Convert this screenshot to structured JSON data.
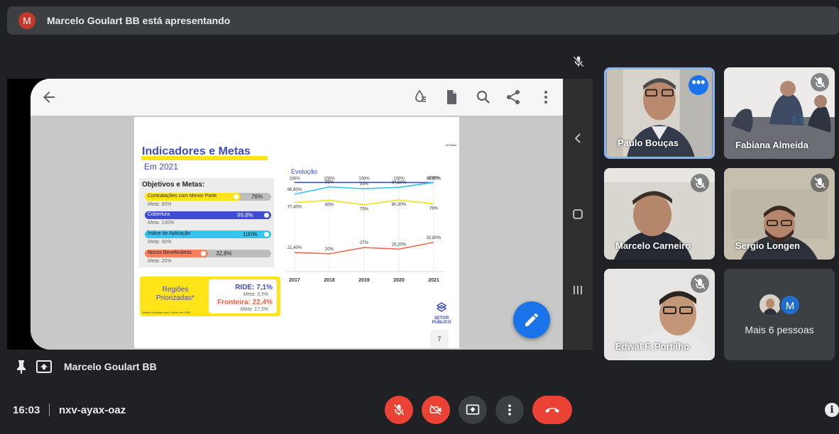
{
  "banner": {
    "avatar_letter": "M",
    "text": "Marcelo Goulart BB está apresentando"
  },
  "slide": {
    "title": "Indicadores e Metas",
    "subtitle": "Em 2021",
    "tag": "#Pública",
    "objectives_title": "Objetivos e Metas:",
    "objectives": [
      {
        "label": "Contratações com Menor Porte",
        "value": "76%",
        "meta": "Meta: 60%",
        "fill": 0.76,
        "color": "#ffe41a"
      },
      {
        "label": "Cobertura",
        "value": "99,8%",
        "meta": "Meta: 100%",
        "fill": 1.0,
        "color": "#3d4bd1"
      },
      {
        "label": "Índice de Aplicação",
        "value": "100%",
        "meta": "Meta: 90%",
        "fill": 1.0,
        "color": "#35c5f0"
      },
      {
        "label": "Novos Beneficiários",
        "value": "32,8%",
        "meta": "Meta: 20%",
        "fill": 0.5,
        "color": "#f68060"
      }
    ],
    "regions": {
      "title": "Regiões Priorizadas*",
      "ride": "RIDE: 7,1%",
      "ride_meta": "Meta: 3,5%",
      "fronteira": "Fronteira: 22,4%",
      "fronteira_meta": "Meta: 17,5%",
      "note": "*Metas iniciadas pelo Condel em 2020"
    },
    "brand": "SETOR PÚBLICO",
    "page_number": "7"
  },
  "chart_data": {
    "type": "line",
    "title": "Evolução",
    "categories": [
      "2017",
      "2018",
      "2019",
      "2020",
      "2021"
    ],
    "ylim": [
      0,
      105
    ],
    "grid": true,
    "series": [
      {
        "color": "#3d4bd1",
        "values": [
          100,
          100,
          100,
          100,
          99.8
        ],
        "labels": [
          "100%",
          "100%",
          "100%",
          "100%",
          "99,80%"
        ]
      },
      {
        "color": "#35c5f0",
        "values": [
          86.8,
          95,
          93,
          94.5,
          100
        ],
        "labels": [
          "86,80%",
          "95%",
          "93%",
          "94,50%",
          "100%"
        ]
      },
      {
        "color": "#f5e01a",
        "values": [
          77.4,
          80,
          75,
          80.3,
          76
        ],
        "labels": [
          "77,40%",
          "80%",
          "75%",
          "80,30%",
          "76%"
        ]
      },
      {
        "color": "#f06a50",
        "values": [
          21.4,
          20,
          27,
          25.2,
          32.8
        ],
        "labels": [
          "21,40%",
          "20%",
          "27%",
          "25,20%",
          "32,80%"
        ]
      }
    ]
  },
  "participants": [
    {
      "name": "Paulo Bouças",
      "active": true
    },
    {
      "name": "Fabiana Almeida",
      "active": false
    },
    {
      "name": "Marcelo Carneiro",
      "active": false
    },
    {
      "name": "Sergio Longen",
      "active": false
    },
    {
      "name": "Edwal F. Portilho",
      "active": false
    }
  ],
  "more_people": {
    "label": "Mais 6 pessoas",
    "avatar_letter": "M"
  },
  "presenter": {
    "name": "Marcelo Goulart BB"
  },
  "footer": {
    "time": "16:03",
    "meeting_code": "nxv-ayax-oaz"
  },
  "colors": {
    "background": "#202124",
    "accent": "#1a73e8",
    "danger": "#ea4335"
  }
}
